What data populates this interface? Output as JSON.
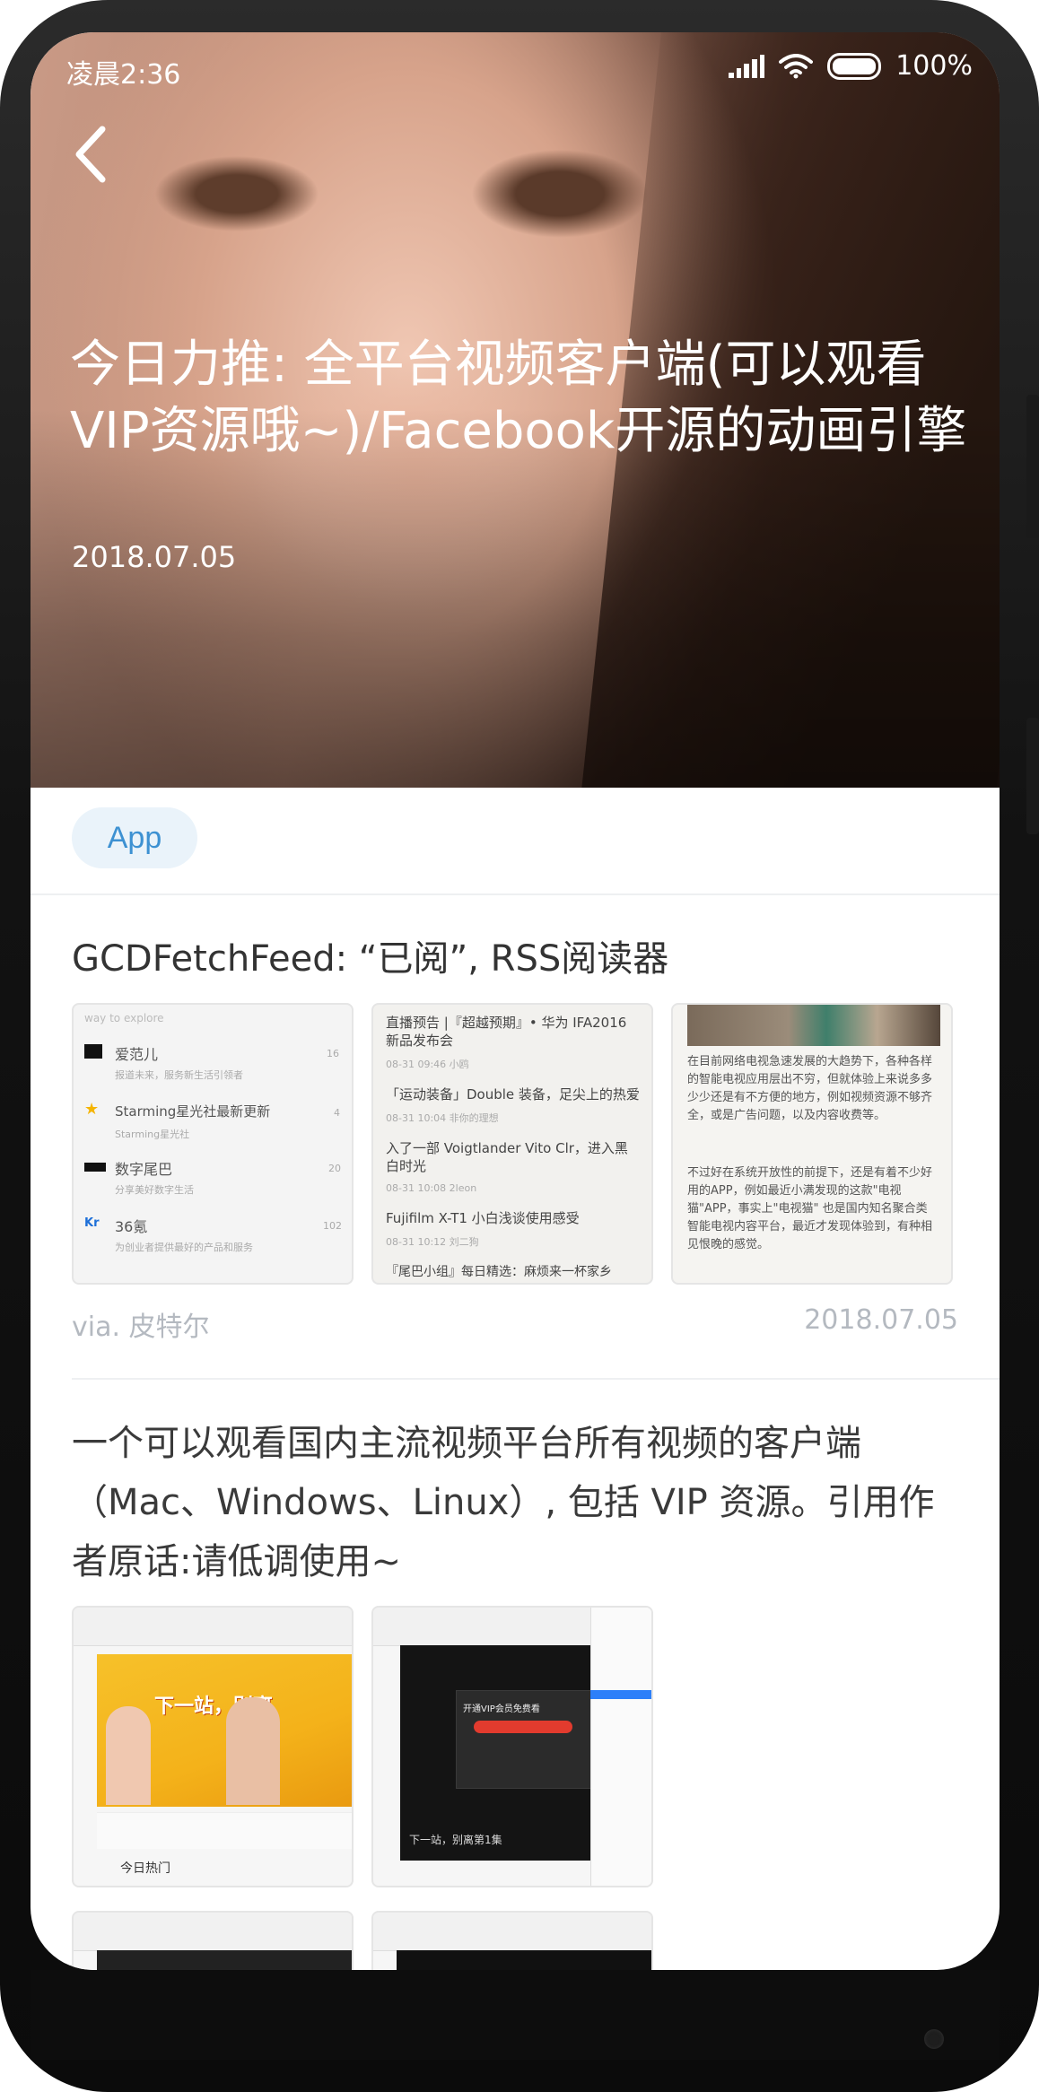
{
  "status_bar": {
    "time": "凌晨2:36",
    "battery": "100%"
  },
  "article": {
    "title": "今日力推: 全平台视频客户端(可以观看VIP资源哦~)/Facebook开源的动画引擎",
    "date": "2018.07.05",
    "tag": "App"
  },
  "section1": {
    "title": "GCDFetchFeed: “已阅”, RSS阅读器",
    "thumb1": {
      "header": "way to explore",
      "items": [
        {
          "name": "爱范儿",
          "desc": "报道未来，服务新生活引领者",
          "count": "16"
        },
        {
          "name": "Starming星光社最新更新",
          "desc": "Starming星光社",
          "count": "4"
        },
        {
          "name": "数字尾巴",
          "desc": "分享美好数字生活",
          "count": "20"
        },
        {
          "name": "36氪",
          "desc": "为创业者提供最好的产品和服务",
          "count": "102"
        }
      ]
    },
    "thumb2": {
      "items": [
        {
          "title": "直播预告 |『超越预期』• 华为 IFA2016 新品发布会",
          "meta": "08-31 09:46  小鸥"
        },
        {
          "title": "「运动装备」Double 装备，足尖上的热爱",
          "meta": "08-31 10:04  非你的理想"
        },
        {
          "title": "入了一部 Voigtlander Vito Clr，进入黑白时光",
          "meta": "08-31 10:08  2leon"
        },
        {
          "title": "Fujifilm X-T1 小白浅谈使用感受",
          "meta": "08-31 10:12  刘二狗"
        },
        {
          "title": "『尾巴小组』每日精选：麻烦来一杯家乡",
          "meta": ""
        }
      ]
    },
    "thumb3": {
      "paragraphs": [
        "在目前网络电视急速发展的大趋势下，各种各样的智能电视应用层出不穷，但就体验上来说多多少少还是有不方便的地方，例如视频资源不够齐全，或是广告问题，以及内容收费等。",
        "不过好在系统开放性的前提下，还是有着不少好用的APP，例如最近小满发现的这款\"电视猫\"APP，事实上\"电视猫\" 也是国内知名聚合类智能电视内容平台，最近才发现体验到，有种相见恨晚的感觉。"
      ]
    },
    "via": "via. 皮特尔",
    "date": "2018.07.05"
  },
  "section2": {
    "body": "一个可以观看国内主流视频平台所有视频的客户端（Mac、Windows、Linux）, 包括 VIP 资源。引用作者原话:请低调使用~",
    "shot1": {
      "banner": "下一站，别离",
      "hot": "今日热门"
    },
    "shot2": {
      "overlay": "开通VIP会员免费看",
      "caption": "下一站，别离第1集"
    }
  },
  "colors": {
    "accent": "#3d91d2",
    "tag_bg": "#eaf3fa",
    "meta_text": "#b4b9c0"
  }
}
